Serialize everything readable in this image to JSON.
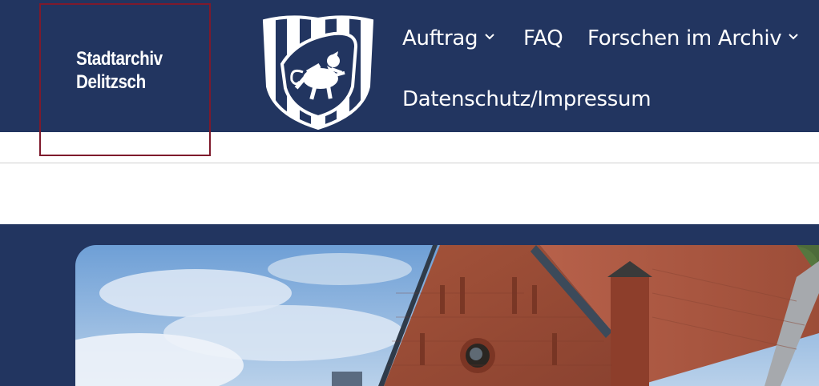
{
  "header": {
    "site_title_line1": "Stadtarchiv",
    "site_title_line2": "Delitzsch",
    "crest_icon": "city-coat-of-arms-lion-icon"
  },
  "nav": {
    "items": [
      {
        "label": "Auftrag",
        "has_dropdown": true
      },
      {
        "label": "FAQ",
        "has_dropdown": false
      },
      {
        "label": "Forschen im Archiv",
        "has_dropdown": true
      },
      {
        "label": "Datenschutz/Impressum",
        "has_dropdown": false
      }
    ]
  },
  "hero": {
    "image_subject": "brick-church-building-photo"
  },
  "colors": {
    "header_bg": "#223560",
    "logo_box_border": "#7e1a2c",
    "text_light": "#ffffff",
    "page_bg": "#ffffff"
  }
}
